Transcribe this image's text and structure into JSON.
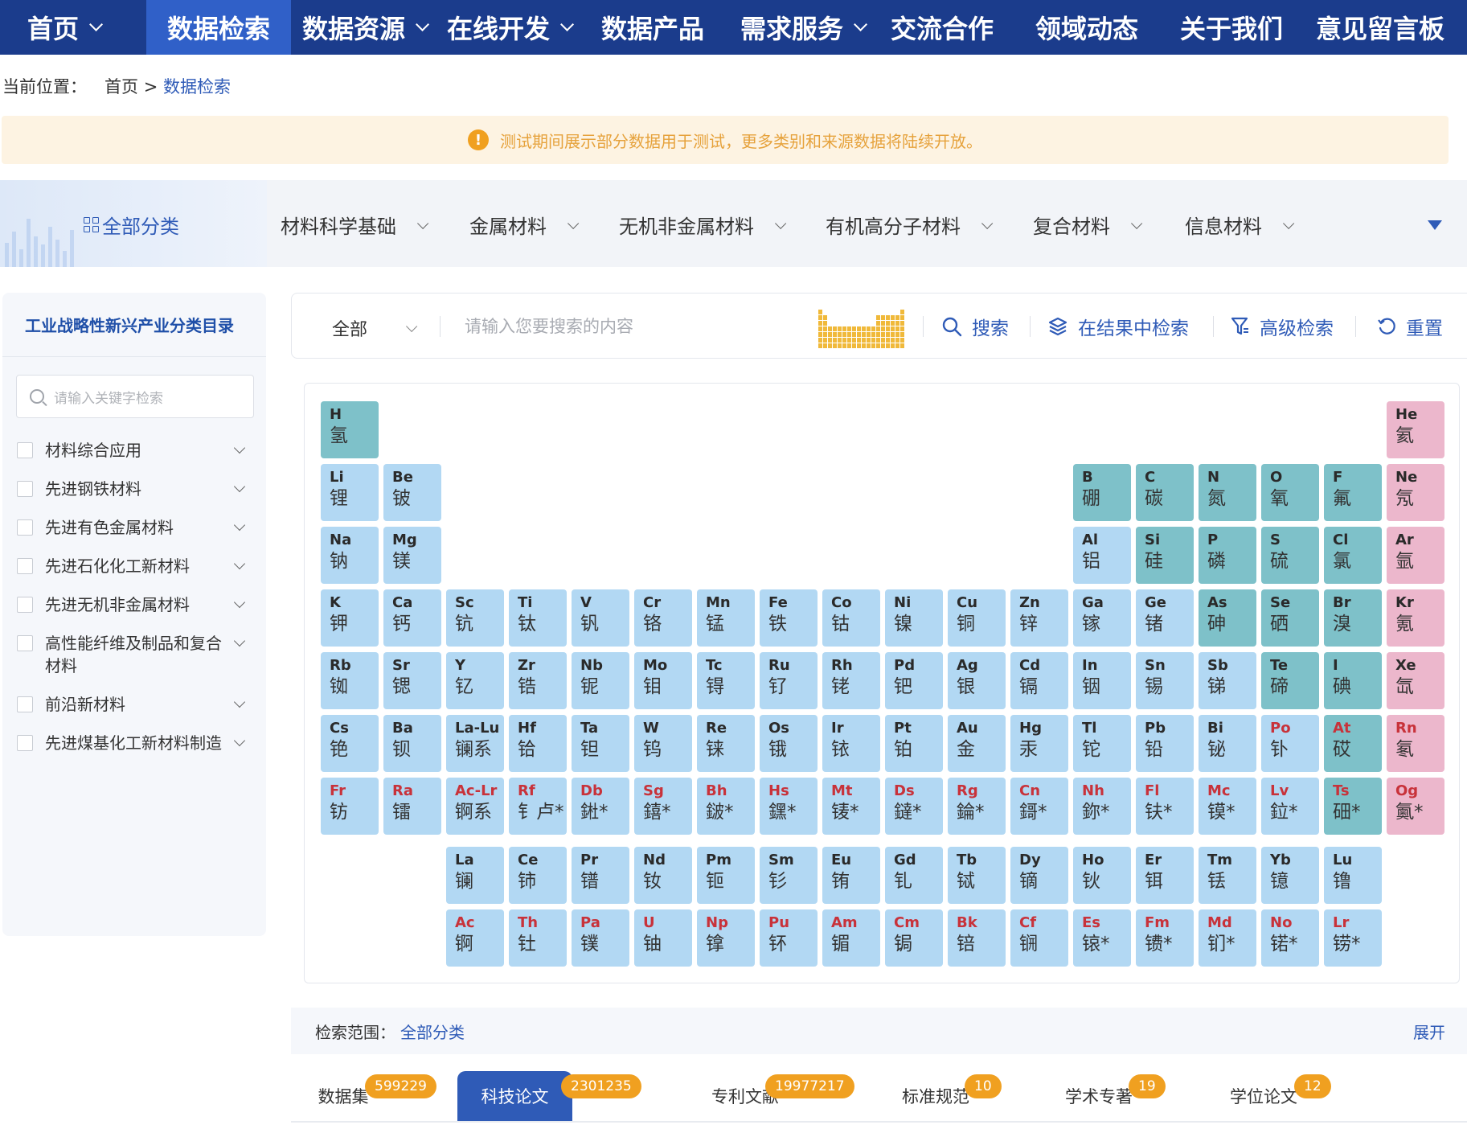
{
  "nav": {
    "items": [
      {
        "label": "首页",
        "dropdown": true
      },
      {
        "label": "数据检索",
        "dropdown": false,
        "active": true
      },
      {
        "label": "数据资源",
        "dropdown": true
      },
      {
        "label": "在线开发",
        "dropdown": true
      },
      {
        "label": "数据产品",
        "dropdown": false
      },
      {
        "label": "需求服务",
        "dropdown": true
      },
      {
        "label": "交流合作",
        "dropdown": false
      },
      {
        "label": "领域动态",
        "dropdown": false
      },
      {
        "label": "关于我们",
        "dropdown": false
      },
      {
        "label": "意见留言板",
        "dropdown": false
      }
    ]
  },
  "breadcrumb": {
    "prefix": "当前位置：",
    "home": "首页",
    "sep": ">",
    "current": "数据检索"
  },
  "notice": {
    "icon": "!",
    "text": "测试期间展示部分数据用于测试，更多类别和来源数据将陆续开放。"
  },
  "categories": {
    "all_label": "全部分类",
    "items": [
      "材料科学基础",
      "金属材料",
      "无机非金属材料",
      "有机高分子材料",
      "复合材料",
      "信息材料"
    ]
  },
  "sidebar": {
    "title": "工业战略性新兴产业分类目录",
    "search_placeholder": "请输入关键字检索",
    "items": [
      "材料综合应用",
      "先进钢铁材料",
      "先进有色金属材料",
      "先进石化化工新材料",
      "先进无机非金属材料",
      "高性能纤维及制品和复合材料",
      "前沿新材料",
      "先进煤基化工新材料制造"
    ]
  },
  "search": {
    "scope_value": "全部",
    "placeholder": "请输入您要搜索的内容",
    "search_label": "搜索",
    "within_label": "在结果中检索",
    "advanced_label": "高级检索",
    "reset_label": "重置"
  },
  "periodic_table": {
    "colors": {
      "blue": "#b2d8f3",
      "teal": "#7ec1c9",
      "pink": "#ecb7cc",
      "red_symbol": "#c8323a"
    },
    "elements": [
      {
        "s": "H",
        "n": "氢",
        "r": 1,
        "c": 1,
        "k": "teal"
      },
      {
        "s": "He",
        "n": "氦",
        "r": 1,
        "c": 18,
        "k": "pink"
      },
      {
        "s": "Li",
        "n": "锂",
        "r": 2,
        "c": 1,
        "k": "blue"
      },
      {
        "s": "Be",
        "n": "铍",
        "r": 2,
        "c": 2,
        "k": "blue"
      },
      {
        "s": "B",
        "n": "硼",
        "r": 2,
        "c": 13,
        "k": "teal"
      },
      {
        "s": "C",
        "n": "碳",
        "r": 2,
        "c": 14,
        "k": "teal"
      },
      {
        "s": "N",
        "n": "氮",
        "r": 2,
        "c": 15,
        "k": "teal"
      },
      {
        "s": "O",
        "n": "氧",
        "r": 2,
        "c": 16,
        "k": "teal"
      },
      {
        "s": "F",
        "n": "氟",
        "r": 2,
        "c": 17,
        "k": "teal"
      },
      {
        "s": "Ne",
        "n": "氖",
        "r": 2,
        "c": 18,
        "k": "pink"
      },
      {
        "s": "Na",
        "n": "钠",
        "r": 3,
        "c": 1,
        "k": "blue"
      },
      {
        "s": "Mg",
        "n": "镁",
        "r": 3,
        "c": 2,
        "k": "blue"
      },
      {
        "s": "Al",
        "n": "铝",
        "r": 3,
        "c": 13,
        "k": "blue"
      },
      {
        "s": "Si",
        "n": "硅",
        "r": 3,
        "c": 14,
        "k": "teal"
      },
      {
        "s": "P",
        "n": "磷",
        "r": 3,
        "c": 15,
        "k": "teal"
      },
      {
        "s": "S",
        "n": "硫",
        "r": 3,
        "c": 16,
        "k": "teal"
      },
      {
        "s": "Cl",
        "n": "氯",
        "r": 3,
        "c": 17,
        "k": "teal"
      },
      {
        "s": "Ar",
        "n": "氩",
        "r": 3,
        "c": 18,
        "k": "pink"
      },
      {
        "s": "K",
        "n": "钾",
        "r": 4,
        "c": 1,
        "k": "blue"
      },
      {
        "s": "Ca",
        "n": "钙",
        "r": 4,
        "c": 2,
        "k": "blue"
      },
      {
        "s": "Sc",
        "n": "钪",
        "r": 4,
        "c": 3,
        "k": "blue"
      },
      {
        "s": "Ti",
        "n": "钛",
        "r": 4,
        "c": 4,
        "k": "blue"
      },
      {
        "s": "V",
        "n": "钒",
        "r": 4,
        "c": 5,
        "k": "blue"
      },
      {
        "s": "Cr",
        "n": "铬",
        "r": 4,
        "c": 6,
        "k": "blue"
      },
      {
        "s": "Mn",
        "n": "锰",
        "r": 4,
        "c": 7,
        "k": "blue"
      },
      {
        "s": "Fe",
        "n": "铁",
        "r": 4,
        "c": 8,
        "k": "blue"
      },
      {
        "s": "Co",
        "n": "钴",
        "r": 4,
        "c": 9,
        "k": "blue"
      },
      {
        "s": "Ni",
        "n": "镍",
        "r": 4,
        "c": 10,
        "k": "blue"
      },
      {
        "s": "Cu",
        "n": "铜",
        "r": 4,
        "c": 11,
        "k": "blue"
      },
      {
        "s": "Zn",
        "n": "锌",
        "r": 4,
        "c": 12,
        "k": "blue"
      },
      {
        "s": "Ga",
        "n": "镓",
        "r": 4,
        "c": 13,
        "k": "blue"
      },
      {
        "s": "Ge",
        "n": "锗",
        "r": 4,
        "c": 14,
        "k": "blue"
      },
      {
        "s": "As",
        "n": "砷",
        "r": 4,
        "c": 15,
        "k": "teal"
      },
      {
        "s": "Se",
        "n": "硒",
        "r": 4,
        "c": 16,
        "k": "teal"
      },
      {
        "s": "Br",
        "n": "溴",
        "r": 4,
        "c": 17,
        "k": "teal"
      },
      {
        "s": "Kr",
        "n": "氪",
        "r": 4,
        "c": 18,
        "k": "pink"
      },
      {
        "s": "Rb",
        "n": "铷",
        "r": 5,
        "c": 1,
        "k": "blue"
      },
      {
        "s": "Sr",
        "n": "锶",
        "r": 5,
        "c": 2,
        "k": "blue"
      },
      {
        "s": "Y",
        "n": "钇",
        "r": 5,
        "c": 3,
        "k": "blue"
      },
      {
        "s": "Zr",
        "n": "锆",
        "r": 5,
        "c": 4,
        "k": "blue"
      },
      {
        "s": "Nb",
        "n": "铌",
        "r": 5,
        "c": 5,
        "k": "blue"
      },
      {
        "s": "Mo",
        "n": "钼",
        "r": 5,
        "c": 6,
        "k": "blue"
      },
      {
        "s": "Tc",
        "n": "锝",
        "r": 5,
        "c": 7,
        "k": "blue"
      },
      {
        "s": "Ru",
        "n": "钌",
        "r": 5,
        "c": 8,
        "k": "blue"
      },
      {
        "s": "Rh",
        "n": "铑",
        "r": 5,
        "c": 9,
        "k": "blue"
      },
      {
        "s": "Pd",
        "n": "钯",
        "r": 5,
        "c": 10,
        "k": "blue"
      },
      {
        "s": "Ag",
        "n": "银",
        "r": 5,
        "c": 11,
        "k": "blue"
      },
      {
        "s": "Cd",
        "n": "镉",
        "r": 5,
        "c": 12,
        "k": "blue"
      },
      {
        "s": "In",
        "n": "铟",
        "r": 5,
        "c": 13,
        "k": "blue"
      },
      {
        "s": "Sn",
        "n": "锡",
        "r": 5,
        "c": 14,
        "k": "blue"
      },
      {
        "s": "Sb",
        "n": "锑",
        "r": 5,
        "c": 15,
        "k": "blue"
      },
      {
        "s": "Te",
        "n": "碲",
        "r": 5,
        "c": 16,
        "k": "teal"
      },
      {
        "s": "I",
        "n": "碘",
        "r": 5,
        "c": 17,
        "k": "teal"
      },
      {
        "s": "Xe",
        "n": "氙",
        "r": 5,
        "c": 18,
        "k": "pink"
      },
      {
        "s": "Cs",
        "n": "铯",
        "r": 6,
        "c": 1,
        "k": "blue"
      },
      {
        "s": "Ba",
        "n": "钡",
        "r": 6,
        "c": 2,
        "k": "blue"
      },
      {
        "s": "La-Lu",
        "n": "镧系",
        "r": 6,
        "c": 3,
        "k": "blue"
      },
      {
        "s": "Hf",
        "n": "铪",
        "r": 6,
        "c": 4,
        "k": "blue"
      },
      {
        "s": "Ta",
        "n": "钽",
        "r": 6,
        "c": 5,
        "k": "blue"
      },
      {
        "s": "W",
        "n": "钨",
        "r": 6,
        "c": 6,
        "k": "blue"
      },
      {
        "s": "Re",
        "n": "铼",
        "r": 6,
        "c": 7,
        "k": "blue"
      },
      {
        "s": "Os",
        "n": "锇",
        "r": 6,
        "c": 8,
        "k": "blue"
      },
      {
        "s": "Ir",
        "n": "铱",
        "r": 6,
        "c": 9,
        "k": "blue"
      },
      {
        "s": "Pt",
        "n": "铂",
        "r": 6,
        "c": 10,
        "k": "blue"
      },
      {
        "s": "Au",
        "n": "金",
        "r": 6,
        "c": 11,
        "k": "blue"
      },
      {
        "s": "Hg",
        "n": "汞",
        "r": 6,
        "c": 12,
        "k": "blue"
      },
      {
        "s": "Tl",
        "n": "铊",
        "r": 6,
        "c": 13,
        "k": "blue"
      },
      {
        "s": "Pb",
        "n": "铅",
        "r": 6,
        "c": 14,
        "k": "blue"
      },
      {
        "s": "Bi",
        "n": "铋",
        "r": 6,
        "c": 15,
        "k": "blue"
      },
      {
        "s": "Po",
        "n": "钋",
        "r": 6,
        "c": 16,
        "k": "blue",
        "red": true
      },
      {
        "s": "At",
        "n": "砹",
        "r": 6,
        "c": 17,
        "k": "teal",
        "red": true
      },
      {
        "s": "Rn",
        "n": "氡",
        "r": 6,
        "c": 18,
        "k": "pink",
        "red": true
      },
      {
        "s": "Fr",
        "n": "钫",
        "r": 7,
        "c": 1,
        "k": "blue",
        "red": true
      },
      {
        "s": "Ra",
        "n": "镭",
        "r": 7,
        "c": 2,
        "k": "blue",
        "red": true
      },
      {
        "s": "Ac-Lr",
        "n": "锕系",
        "r": 7,
        "c": 3,
        "k": "blue",
        "red": true
      },
      {
        "s": "Rf",
        "n": "钅卢*",
        "r": 7,
        "c": 4,
        "k": "blue",
        "red": true
      },
      {
        "s": "Db",
        "n": "𨧀*",
        "r": 7,
        "c": 5,
        "k": "blue",
        "red": true
      },
      {
        "s": "Sg",
        "n": "𨭎*",
        "r": 7,
        "c": 6,
        "k": "blue",
        "red": true
      },
      {
        "s": "Bh",
        "n": "𨨏*",
        "r": 7,
        "c": 7,
        "k": "blue",
        "red": true
      },
      {
        "s": "Hs",
        "n": "𨭆*",
        "r": 7,
        "c": 8,
        "k": "blue",
        "red": true
      },
      {
        "s": "Mt",
        "n": "鿏*",
        "r": 7,
        "c": 9,
        "k": "blue",
        "red": true
      },
      {
        "s": "Ds",
        "n": "鐽*",
        "r": 7,
        "c": 10,
        "k": "blue",
        "red": true
      },
      {
        "s": "Rg",
        "n": "錀*",
        "r": 7,
        "c": 11,
        "k": "blue",
        "red": true
      },
      {
        "s": "Cn",
        "n": "鎶*",
        "r": 7,
        "c": 12,
        "k": "blue",
        "red": true
      },
      {
        "s": "Nh",
        "n": "鉨*",
        "r": 7,
        "c": 13,
        "k": "blue",
        "red": true
      },
      {
        "s": "Fl",
        "n": "𫓧*",
        "r": 7,
        "c": 14,
        "k": "blue",
        "red": true
      },
      {
        "s": "Mc",
        "n": "镆*",
        "r": 7,
        "c": 15,
        "k": "blue",
        "red": true
      },
      {
        "s": "Lv",
        "n": "鉝*",
        "r": 7,
        "c": 16,
        "k": "blue",
        "red": true
      },
      {
        "s": "Ts",
        "n": "鿬*",
        "r": 7,
        "c": 17,
        "k": "teal",
        "red": true
      },
      {
        "s": "Og",
        "n": "鿫*",
        "r": 7,
        "c": 18,
        "k": "pink",
        "red": true
      },
      {
        "s": "La",
        "n": "镧",
        "r": 9,
        "c": 3,
        "k": "blue"
      },
      {
        "s": "Ce",
        "n": "铈",
        "r": 9,
        "c": 4,
        "k": "blue"
      },
      {
        "s": "Pr",
        "n": "镨",
        "r": 9,
        "c": 5,
        "k": "blue"
      },
      {
        "s": "Nd",
        "n": "钕",
        "r": 9,
        "c": 6,
        "k": "blue"
      },
      {
        "s": "Pm",
        "n": "钷",
        "r": 9,
        "c": 7,
        "k": "blue"
      },
      {
        "s": "Sm",
        "n": "钐",
        "r": 9,
        "c": 8,
        "k": "blue"
      },
      {
        "s": "Eu",
        "n": "铕",
        "r": 9,
        "c": 9,
        "k": "blue"
      },
      {
        "s": "Gd",
        "n": "钆",
        "r": 9,
        "c": 10,
        "k": "blue"
      },
      {
        "s": "Tb",
        "n": "铽",
        "r": 9,
        "c": 11,
        "k": "blue"
      },
      {
        "s": "Dy",
        "n": "镝",
        "r": 9,
        "c": 12,
        "k": "blue"
      },
      {
        "s": "Ho",
        "n": "钬",
        "r": 9,
        "c": 13,
        "k": "blue"
      },
      {
        "s": "Er",
        "n": "铒",
        "r": 9,
        "c": 14,
        "k": "blue"
      },
      {
        "s": "Tm",
        "n": "铥",
        "r": 9,
        "c": 15,
        "k": "blue"
      },
      {
        "s": "Yb",
        "n": "镱",
        "r": 9,
        "c": 16,
        "k": "blue"
      },
      {
        "s": "Lu",
        "n": "镥",
        "r": 9,
        "c": 17,
        "k": "blue"
      },
      {
        "s": "Ac",
        "n": "锕",
        "r": 10,
        "c": 3,
        "k": "blue",
        "red": true
      },
      {
        "s": "Th",
        "n": "钍",
        "r": 10,
        "c": 4,
        "k": "blue",
        "red": true
      },
      {
        "s": "Pa",
        "n": "镤",
        "r": 10,
        "c": 5,
        "k": "blue",
        "red": true
      },
      {
        "s": "U",
        "n": "铀",
        "r": 10,
        "c": 6,
        "k": "blue",
        "red": true
      },
      {
        "s": "Np",
        "n": "镎",
        "r": 10,
        "c": 7,
        "k": "blue",
        "red": true
      },
      {
        "s": "Pu",
        "n": "钚",
        "r": 10,
        "c": 8,
        "k": "blue",
        "red": true
      },
      {
        "s": "Am",
        "n": "镅",
        "r": 10,
        "c": 9,
        "k": "blue",
        "red": true
      },
      {
        "s": "Cm",
        "n": "锔",
        "r": 10,
        "c": 10,
        "k": "blue",
        "red": true
      },
      {
        "s": "Bk",
        "n": "锫",
        "r": 10,
        "c": 11,
        "k": "blue",
        "red": true
      },
      {
        "s": "Cf",
        "n": "锎",
        "r": 10,
        "c": 12,
        "k": "blue",
        "red": true
      },
      {
        "s": "Es",
        "n": "锿*",
        "r": 10,
        "c": 13,
        "k": "blue",
        "red": true
      },
      {
        "s": "Fm",
        "n": "镄*",
        "r": 10,
        "c": 14,
        "k": "blue",
        "red": true
      },
      {
        "s": "Md",
        "n": "钔*",
        "r": 10,
        "c": 15,
        "k": "blue",
        "red": true
      },
      {
        "s": "No",
        "n": "锘*",
        "r": 10,
        "c": 16,
        "k": "blue",
        "red": true
      },
      {
        "s": "Lr",
        "n": "铹*",
        "r": 10,
        "c": 17,
        "k": "blue",
        "red": true
      }
    ]
  },
  "scope": {
    "label": "检索范围：",
    "value": "全部分类",
    "expand_label": "展开"
  },
  "tabs": [
    {
      "label": "数据集",
      "count": "599229"
    },
    {
      "label": "科技论文",
      "count": "2301235",
      "active": true
    },
    {
      "label": "专利文献",
      "count": "19977217"
    },
    {
      "label": "标准规范",
      "count": "10"
    },
    {
      "label": "学术专著",
      "count": "19"
    },
    {
      "label": "学位论文",
      "count": "12"
    }
  ]
}
